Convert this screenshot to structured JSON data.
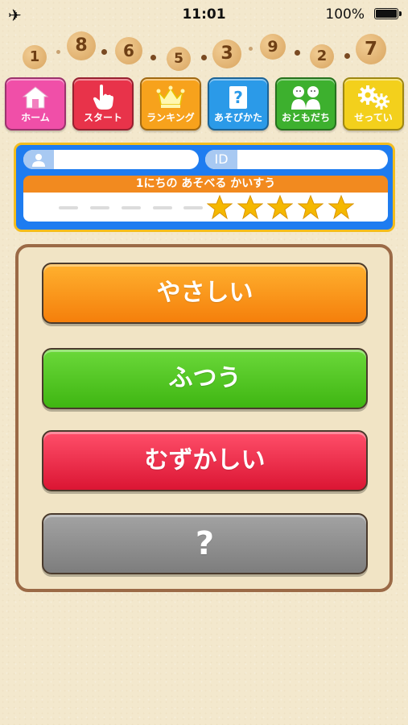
{
  "status_bar": {
    "time": "11:01",
    "battery": "100%",
    "airplane_icon": "airplane-icon",
    "battery_icon": "battery-icon"
  },
  "numbers": [
    "1",
    "8",
    "6",
    "5",
    "3",
    "9",
    "2",
    "7"
  ],
  "nav": [
    {
      "label": "ホーム",
      "icon": "home-icon",
      "color": "#f04fa8"
    },
    {
      "label": "スタート",
      "icon": "pointing-hand-icon",
      "color": "#e8334a"
    },
    {
      "label": "ランキング",
      "icon": "crown-icon",
      "color": "#f7a21c"
    },
    {
      "label": "あそびかた",
      "icon": "help-book-icon",
      "color": "#2b9ae8"
    },
    {
      "label": "おともだち",
      "icon": "friends-icon",
      "color": "#3db02e"
    },
    {
      "label": "せってい",
      "icon": "gears-icon",
      "color": "#f3d01c"
    }
  ],
  "profile": {
    "user_icon": "user-icon",
    "id_label": "ID",
    "username": "",
    "user_id": ""
  },
  "daily_plays": {
    "label": "1にちの あそべる かいすう",
    "max": 5,
    "remaining": 5,
    "star_color": "#f5b800"
  },
  "difficulty": [
    {
      "label": "やさしい",
      "color": "#f88c14"
    },
    {
      "label": "ふつう",
      "color": "#4ec51f"
    },
    {
      "label": "むずかしい",
      "color": "#e8213f"
    },
    {
      "label": "?",
      "color": "#8d8d8d"
    }
  ]
}
